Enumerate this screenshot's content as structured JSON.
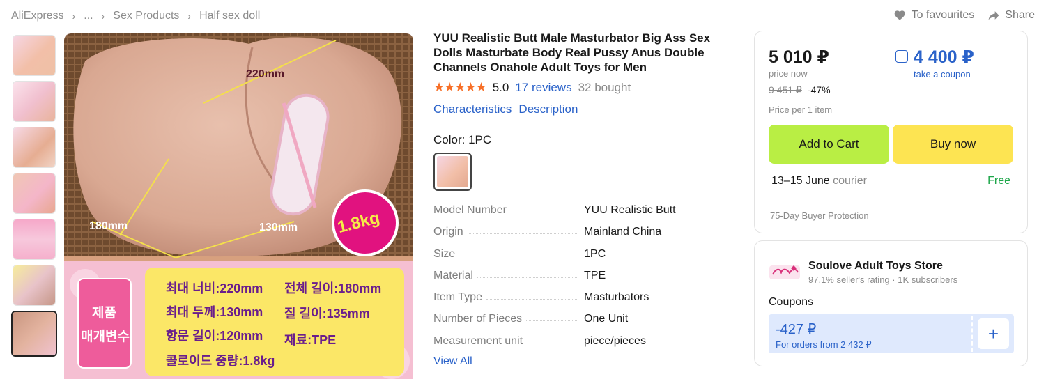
{
  "breadcrumb": [
    "AliExpress",
    "...",
    "Sex Products",
    "Half sex doll"
  ],
  "top_actions": {
    "favourites": "To favourites",
    "share": "Share"
  },
  "product": {
    "title": "YUU Realistic Butt Male Masturbator Big Ass Sex Dolls Masturbate Body Real Pussy Anus Double Channels Onahole Adult Toys for Men",
    "stars": "★★★★★",
    "rating": "5.0",
    "reviews": "17 reviews",
    "bought": "32 bought",
    "tabs": [
      "Characteristics",
      "Description"
    ],
    "color_label": "Color: 1PC",
    "image_text": {
      "dim_width": "220mm",
      "dim_depth": "180mm",
      "dim_height": "130mm",
      "weight": "1.8kg",
      "side_title_1": "제품",
      "side_title_2": "매개변수",
      "spec_lines": [
        "최대 너비:220mm",
        "전체 길이:180mm",
        "최대 두께:130mm",
        "질 길이:135mm",
        "항문 길이:120mm",
        "재료:TPE",
        "콜로이드 중량:1.8kg"
      ]
    },
    "specs": [
      {
        "key": "Model Number",
        "value": "YUU Realistic Butt"
      },
      {
        "key": "Origin",
        "value": "Mainland China"
      },
      {
        "key": "Size",
        "value": "1PC"
      },
      {
        "key": "Material",
        "value": "TPE"
      },
      {
        "key": "Item Type",
        "value": "Masturbators"
      },
      {
        "key": "Number of Pieces",
        "value": "One Unit"
      },
      {
        "key": "Measurement unit",
        "value": "piece/pieces"
      }
    ],
    "view_all": "View All"
  },
  "price_panel": {
    "price_now": "5 010 ₽",
    "price_now_label": "price now",
    "price_old": "9 451 ₽",
    "discount": "-47%",
    "coupon_price": "4 400 ₽",
    "coupon_label": "take a coupon",
    "per_item": "Price per 1 item",
    "add_to_cart": "Add to Cart",
    "buy_now": "Buy now",
    "delivery_dates": "13–15 June",
    "delivery_method": "courier",
    "delivery_cost": "Free",
    "protection": "75-Day Buyer Protection"
  },
  "store": {
    "name": "Soulove Adult Toys Store",
    "rating": "97,1% seller's rating",
    "subscribers": "1K subscribers",
    "coupons_label": "Coupons",
    "coupon_amount": "-427 ₽",
    "coupon_condition": "For orders from 2 432 ₽",
    "add": "+"
  },
  "colors": {
    "link": "#2a62c9",
    "cart_button": "#b9ee44",
    "buy_button": "#fde452",
    "free": "#1ea64a",
    "stars": "#f76f27"
  }
}
